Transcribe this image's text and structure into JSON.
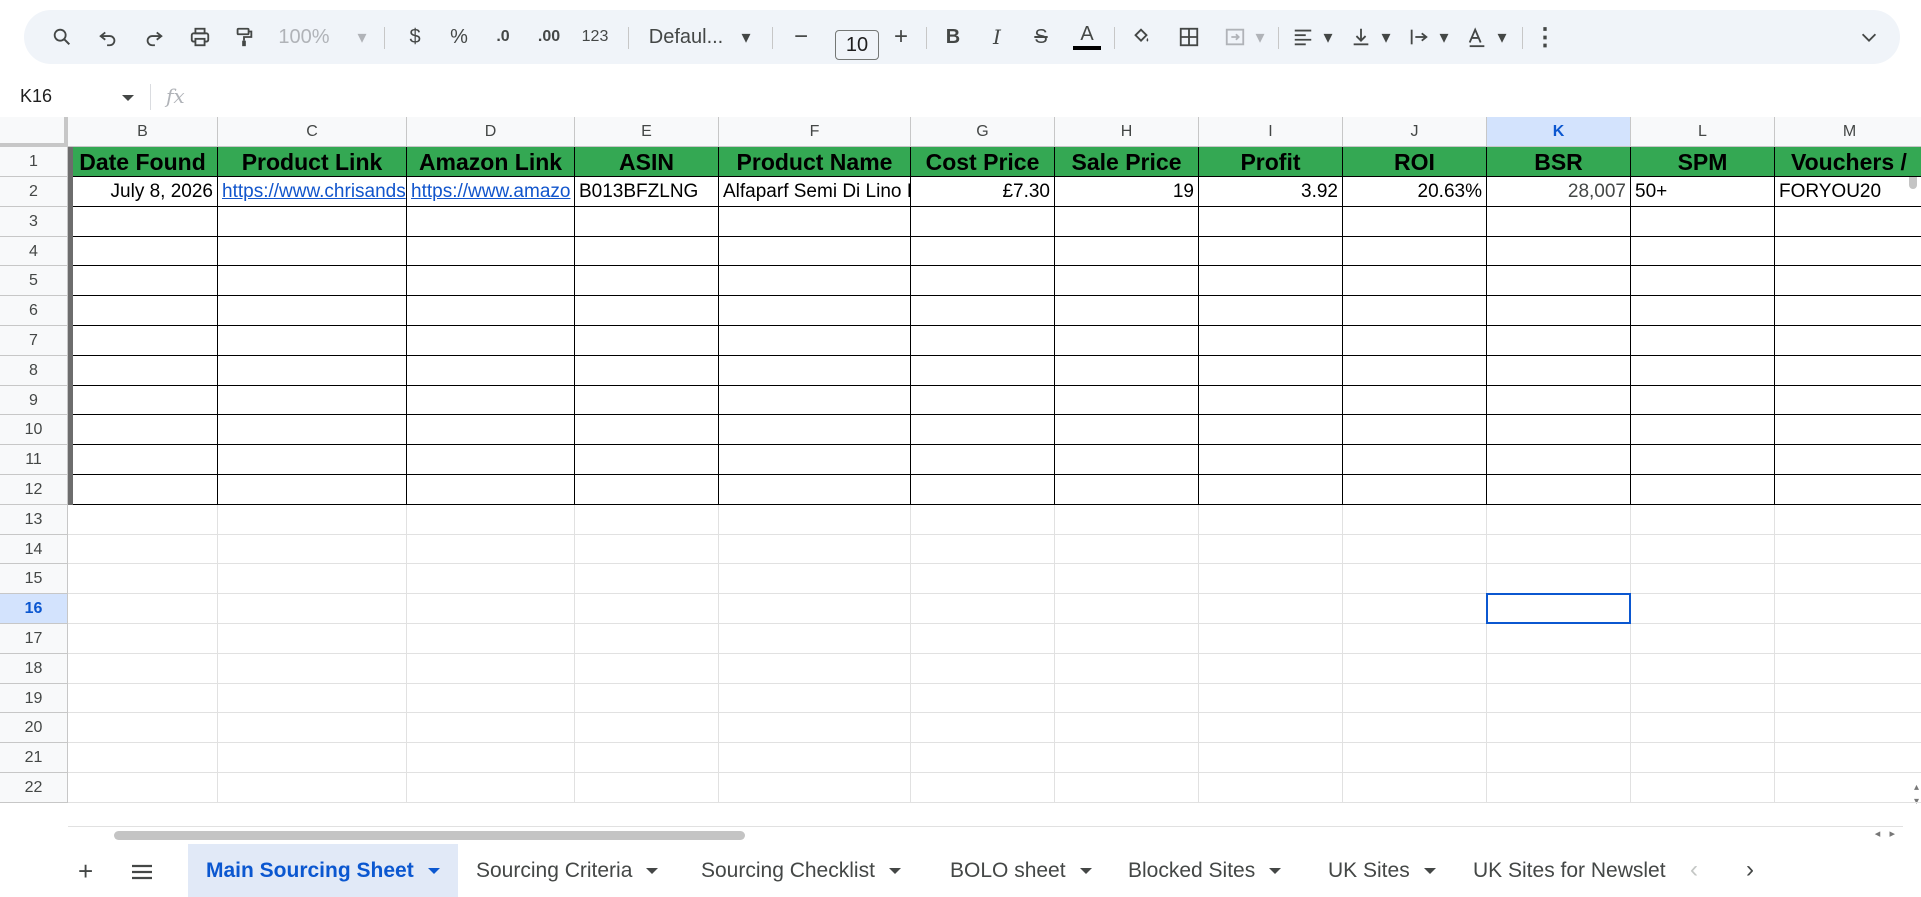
{
  "toolbar": {
    "zoom": "100%",
    "currency_label": "$",
    "percent_label": "%",
    "decrease_decimal_label": ".0",
    "increase_decimal_label": ".00",
    "number_format_label": "123",
    "font_name": "Defaul...",
    "font_size": "10",
    "bold_label": "B",
    "italic_label": "I",
    "strike_label": "S",
    "text_color_label": "A",
    "text_color_bar": "#000000"
  },
  "formula_bar": {
    "cell_ref": "K16",
    "fx_label": "fx",
    "formula": ""
  },
  "columns": [
    "B",
    "C",
    "D",
    "E",
    "F",
    "G",
    "H",
    "I",
    "J",
    "K",
    "L",
    "M"
  ],
  "selected_column": "K",
  "rows": [
    "1",
    "2",
    "3",
    "4",
    "5",
    "6",
    "7",
    "8",
    "9",
    "10",
    "11",
    "12",
    "13",
    "14",
    "15",
    "16",
    "17",
    "18",
    "19",
    "20",
    "21",
    "22"
  ],
  "selected_row": "16",
  "header_row": [
    "Date Found",
    "Product Link",
    "Amazon Link",
    "ASIN",
    "Product Name",
    "Cost Price",
    "Sale Price",
    "Profit",
    "ROI",
    "BSR",
    "SPM",
    "Vouchers /"
  ],
  "data_rows": [
    [
      "July 8, 2026",
      "https://www.chrisands",
      "https://www.amazo",
      "B013BFZLNG",
      "Alfaparf Semi Di Lino I",
      "£7.30",
      "19",
      "3.92",
      "20.63%",
      "28,007",
      "50+",
      "FORYOU20"
    ]
  ],
  "colors": {
    "header_fill": "#34a853",
    "selection": "#0b57d0",
    "link": "#1155cc"
  },
  "sheet_tabs": [
    {
      "label": "Main Sourcing Sheet",
      "active": true
    },
    {
      "label": "Sourcing Criteria",
      "active": false
    },
    {
      "label": "Sourcing Checklist",
      "active": false
    },
    {
      "label": "BOLO sheet",
      "active": false
    },
    {
      "label": "Blocked Sites",
      "active": false
    },
    {
      "label": "UK Sites",
      "active": false
    },
    {
      "label": "UK Sites for Newslet",
      "active": false
    }
  ]
}
